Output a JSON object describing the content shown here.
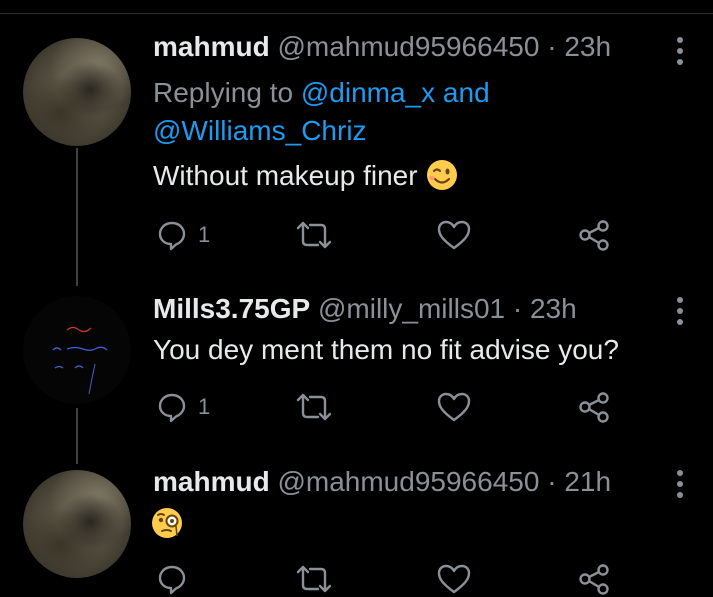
{
  "tweets": [
    {
      "name": "mahmud",
      "handle": "@mahmud95966450",
      "separator": "·",
      "time": "23h",
      "replying_prefix": "Replying to",
      "mention1": "@dinma_x",
      "conjunction": "and",
      "mention2": "@Williams_Chriz",
      "text": "Without makeup finer",
      "emoji": "winking-face",
      "reply_count": "1"
    },
    {
      "name": "Mills3.75GP",
      "handle": "@milly_mills01",
      "separator": "·",
      "time": "23h",
      "text": "You dey ment them no fit advise you?",
      "reply_count": "1"
    },
    {
      "name": "mahmud",
      "handle": "@mahmud95966450",
      "separator": "·",
      "time": "21h",
      "emoji": "face-with-monocle"
    }
  ],
  "colors": {
    "background": "#000000",
    "primary_text": "#e7e9ea",
    "secondary_text": "#8b9096",
    "mention": "#1d9bf0",
    "thread_line": "#3e4144"
  }
}
